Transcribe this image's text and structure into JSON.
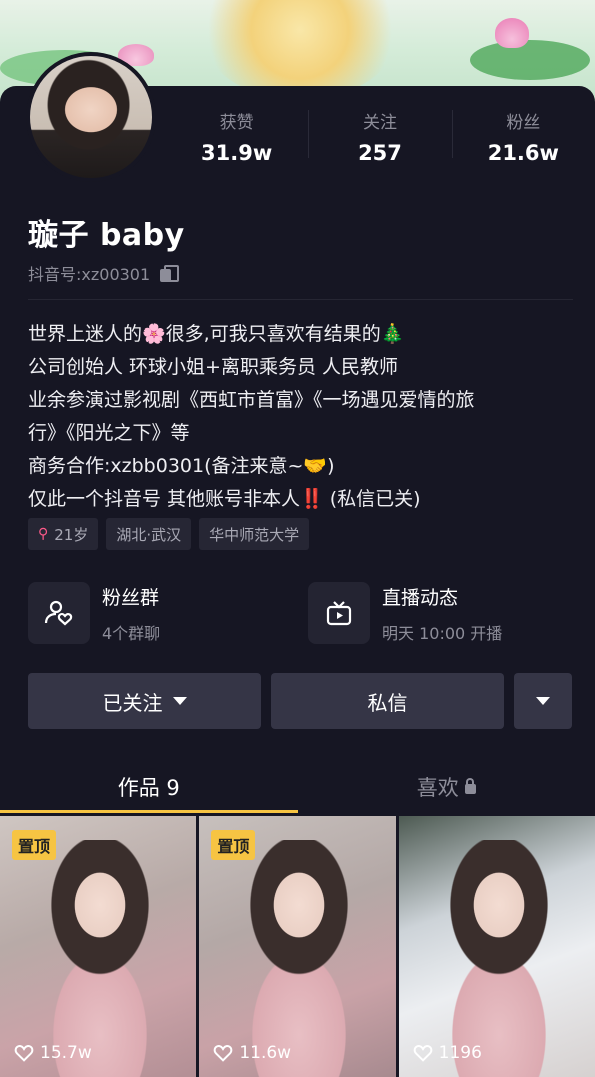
{
  "profile": {
    "name": "璇子 baby",
    "douyin_id": "抖音号:xz00301"
  },
  "stats": [
    {
      "label": "获赞",
      "value": "31.9w"
    },
    {
      "label": "关注",
      "value": "257"
    },
    {
      "label": "粉丝",
      "value": "21.6w"
    }
  ],
  "bio": [
    "世界上迷人的🌸很多,可我只喜欢有结果的🎄",
    "公司创始人 环球小姐+离职乘务员 人民教师",
    "业余参演过影视剧《西虹市首富》《一场遇见爱情的旅",
    "行》《阳光之下》等",
    "商务合作:xzbb0301(备注来意~🤝)",
    "仅此一个抖音号 其他账号非本人‼️ (私信已关)"
  ],
  "tags": {
    "age": "21岁",
    "location": "湖北·武汉",
    "school": "华中师范大学"
  },
  "entries": {
    "fan_group": {
      "title": "粉丝群",
      "subtitle": "4个群聊"
    },
    "live": {
      "title": "直播动态",
      "subtitle": "明天 10:00 开播"
    }
  },
  "actions": {
    "follow_label": "已关注",
    "message_label": "私信"
  },
  "tabs": {
    "works_label": "作品 9",
    "likes_label": "喜欢"
  },
  "videos": [
    {
      "pinned_label": "置顶",
      "likes": "15.7w"
    },
    {
      "pinned_label": "置顶",
      "likes": "11.6w"
    },
    {
      "likes": "1196"
    }
  ],
  "colors": {
    "background": "#161623",
    "accent": "#f6c443",
    "button": "#353546",
    "muted_text": "#8d8d99"
  }
}
